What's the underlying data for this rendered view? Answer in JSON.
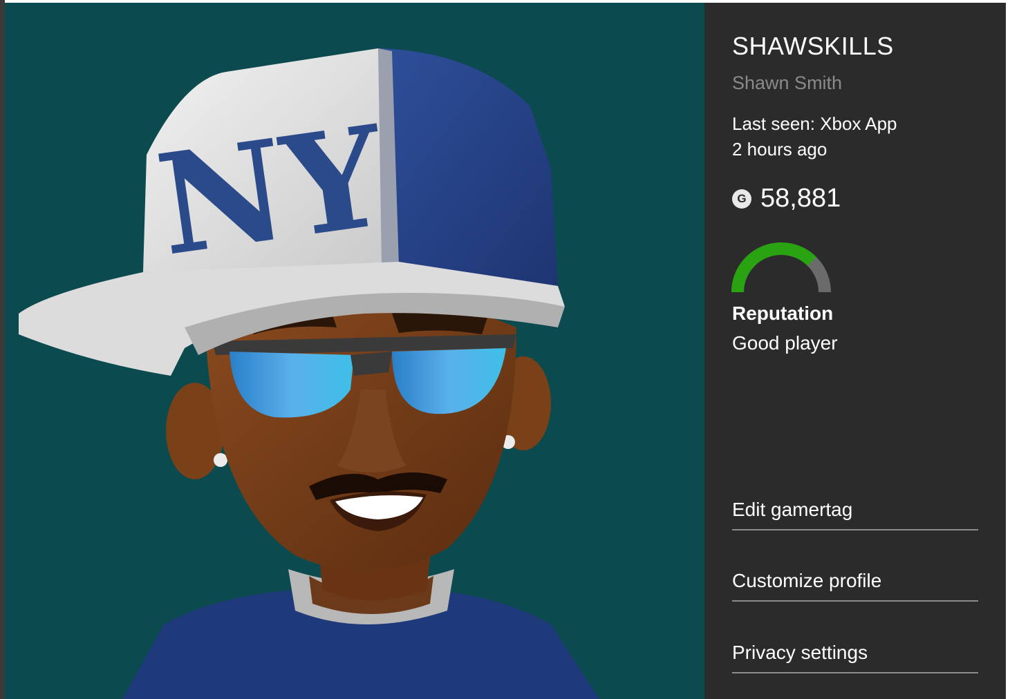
{
  "profile": {
    "gamertag": "SHAWSKILLS",
    "real_name": "Shawn Smith",
    "last_seen": "Last seen: Xbox App",
    "last_seen_time": "2 hours ago",
    "gamerscore": "58,881",
    "gamerscore_icon": "gamerscore-g-icon",
    "reputation_title": "Reputation",
    "reputation_value": "Good player",
    "reputation_level": 0.75
  },
  "actions": [
    {
      "label": "Edit gamertag"
    },
    {
      "label": "Customize profile"
    },
    {
      "label": "Privacy settings"
    }
  ],
  "colors": {
    "avatar_background": "#0b4a4f",
    "panel_background": "#2b2b2b",
    "reputation_good": "#2aa313",
    "reputation_track": "#6b6b6b",
    "secondary_text": "#8a8a8a"
  }
}
